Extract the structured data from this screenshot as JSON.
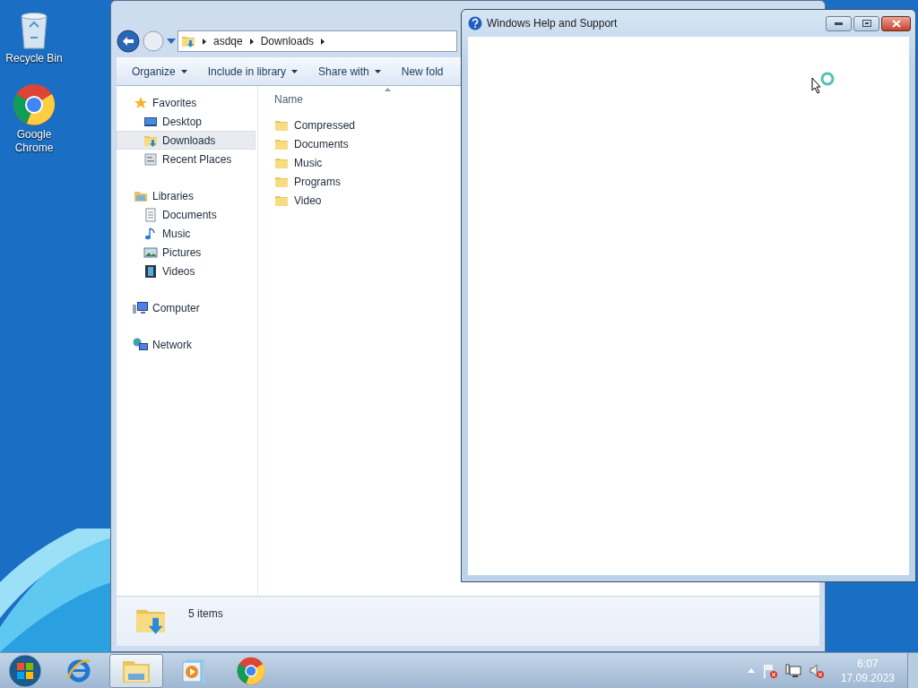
{
  "desktop_icons": [
    {
      "kind": "recycle",
      "label": "Recycle Bin"
    },
    {
      "kind": "chrome",
      "label": "Google Chrome"
    }
  ],
  "explorer": {
    "breadcrumb": [
      "asdqe",
      "Downloads"
    ],
    "toolbar": [
      {
        "label": "Organize",
        "dropdown": true
      },
      {
        "label": "Include in library",
        "dropdown": true
      },
      {
        "label": "Share with",
        "dropdown": true
      },
      {
        "label": "New fold",
        "dropdown": false
      }
    ],
    "navigation": [
      {
        "kind": "star",
        "label": "Favorites",
        "children": [
          {
            "kind": "desktop",
            "label": "Desktop",
            "selected": false
          },
          {
            "kind": "downloads",
            "label": "Downloads",
            "selected": true
          },
          {
            "kind": "recent",
            "label": "Recent Places",
            "selected": false
          }
        ]
      },
      {
        "kind": "library",
        "label": "Libraries",
        "children": [
          {
            "kind": "document",
            "label": "Documents",
            "selected": false
          },
          {
            "kind": "music",
            "label": "Music",
            "selected": false
          },
          {
            "kind": "pictures",
            "label": "Pictures",
            "selected": false
          },
          {
            "kind": "videos",
            "label": "Videos",
            "selected": false
          }
        ]
      },
      {
        "kind": "computer",
        "label": "Computer"
      },
      {
        "kind": "network",
        "label": "Network"
      }
    ],
    "column_header": "Name",
    "files": [
      "Compressed",
      "Documents",
      "Music",
      "Programs",
      "Video"
    ],
    "status": "5 items"
  },
  "help_window": {
    "title": "Windows Help and Support"
  },
  "taskbar": {
    "items": [
      {
        "kind": "start",
        "selected": false
      },
      {
        "kind": "ie",
        "selected": false
      },
      {
        "kind": "explorer",
        "selected": true
      },
      {
        "kind": "media",
        "selected": false
      },
      {
        "kind": "chrome",
        "selected": false
      }
    ],
    "time": "6:07",
    "date": "17.09.2023"
  }
}
